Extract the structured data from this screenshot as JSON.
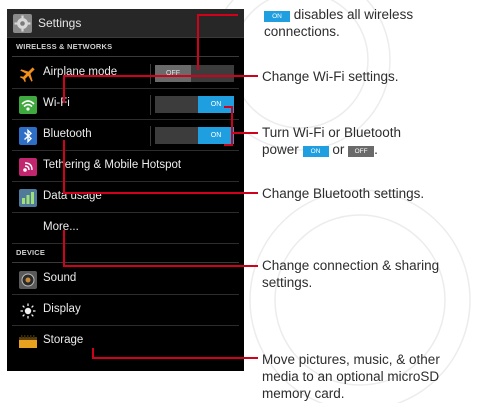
{
  "screen": {
    "title": "Settings",
    "sections": {
      "wireless": "WIRELESS & NETWORKS",
      "device": "DEVICE"
    },
    "rows": {
      "airplane": "Airplane mode",
      "wifi": "Wi-Fi",
      "bluetooth": "Bluetooth",
      "tethering": "Tethering & Mobile Hotspot",
      "data_usage": "Data usage",
      "more": "More...",
      "sound": "Sound",
      "display": "Display",
      "storage": "Storage"
    },
    "toggles": {
      "airplane": "OFF",
      "wifi": "ON",
      "bluetooth": "ON"
    }
  },
  "callouts": {
    "airplane_chip": "ON",
    "airplane_text": "disables all wireless connections.",
    "wifi": "Change Wi-Fi settings.",
    "toggle_line1": "Turn Wi-Fi  or Bluetooth",
    "toggle_power": "power",
    "toggle_chip_on": "ON",
    "toggle_or": "or",
    "toggle_chip_off": "OFF",
    "toggle_end": ".",
    "bluetooth": "Change Bluetooth settings.",
    "more_line1": "Change connection & sharing",
    "more_line2": "settings.",
    "storage_line1": "Move pictures, music, & other",
    "storage_line2": "media to an optional microSD",
    "storage_line3": "memory card."
  },
  "colors": {
    "callout_line": "#d0021b",
    "toggle_on": "#1f9ee0",
    "toggle_off": "#6a6a6a",
    "screen_bg": "#000000"
  },
  "icons": {
    "settings": "settings-icon",
    "airplane": "airplane-icon",
    "wifi": "wifi-icon",
    "bluetooth": "bluetooth-icon",
    "tethering": "hotspot-icon",
    "data_usage": "data-usage-icon",
    "sound": "speaker-icon",
    "display": "brightness-icon",
    "storage": "sd-card-icon"
  }
}
